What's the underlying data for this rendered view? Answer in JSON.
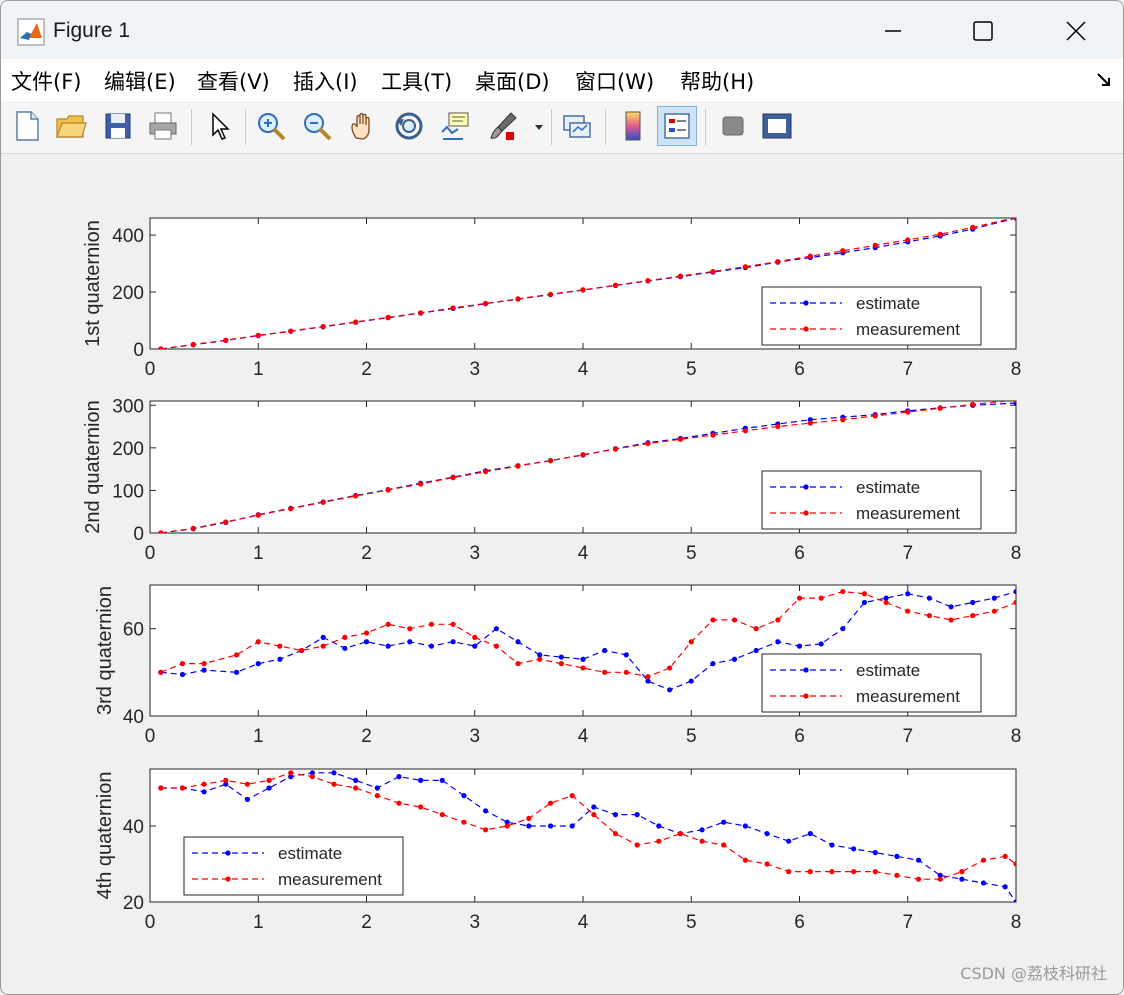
{
  "window": {
    "title": "Figure 1"
  },
  "menu": [
    {
      "label": "文件(F)"
    },
    {
      "label": "编辑(E)"
    },
    {
      "label": "查看(V)"
    },
    {
      "label": "插入(I)"
    },
    {
      "label": "工具(T)"
    },
    {
      "label": "桌面(D)"
    },
    {
      "label": "窗口(W)"
    },
    {
      "label": "帮助(H)"
    }
  ],
  "toolbar": [
    {
      "icon": "new-figure-icon"
    },
    {
      "icon": "open-file-icon"
    },
    {
      "icon": "save-icon"
    },
    {
      "icon": "print-icon"
    },
    {
      "icon": "pointer-icon"
    },
    {
      "icon": "zoom-in-icon"
    },
    {
      "icon": "zoom-out-icon"
    },
    {
      "icon": "pan-hand-icon"
    },
    {
      "icon": "rotate-3d-icon"
    },
    {
      "icon": "data-cursor-icon"
    },
    {
      "icon": "brush-icon"
    },
    {
      "icon": "link-plot-icon"
    },
    {
      "icon": "colorbar-icon"
    },
    {
      "icon": "legend-icon"
    },
    {
      "icon": "hide-plot-tools-icon"
    },
    {
      "icon": "show-plot-tools-icon"
    }
  ],
  "colors": {
    "estimate": "#0000ff",
    "measurement": "#ff0000"
  },
  "watermark": "CSDN @荔枝科研社",
  "chart_data": [
    {
      "type": "line",
      "ylabel": "1st quaternion",
      "xlim": [
        0,
        8
      ],
      "ylim": [
        0,
        460
      ],
      "xticks": [
        "0",
        "1",
        "2",
        "3",
        "4",
        "5",
        "6",
        "7",
        "8"
      ],
      "yticks": [
        0,
        200,
        400
      ],
      "grid": false,
      "legend": "bottom-right",
      "series": [
        {
          "name": "estimate",
          "color": "#0000ff",
          "x": [
            0.1,
            0.4,
            0.7,
            1.0,
            1.3,
            1.6,
            1.9,
            2.2,
            2.5,
            2.8,
            3.1,
            3.4,
            3.7,
            4.0,
            4.3,
            4.6,
            4.9,
            5.2,
            5.5,
            5.8,
            6.1,
            6.4,
            6.7,
            7.0,
            7.3,
            7.6,
            8.0
          ],
          "y": [
            0,
            15,
            30,
            47,
            62,
            78,
            94,
            110,
            126,
            142,
            159,
            175,
            191,
            207,
            223,
            239,
            254,
            270,
            286,
            305,
            321,
            338,
            356,
            376,
            397,
            421,
            460
          ]
        },
        {
          "name": "measurement",
          "color": "#ff0000",
          "x": [
            0.1,
            0.4,
            0.7,
            1.0,
            1.3,
            1.6,
            1.9,
            2.2,
            2.5,
            2.8,
            3.1,
            3.4,
            3.7,
            4.0,
            4.3,
            4.6,
            4.9,
            5.2,
            5.5,
            5.8,
            6.1,
            6.4,
            6.7,
            7.0,
            7.3,
            7.6,
            8.0
          ],
          "y": [
            0,
            16,
            31,
            48,
            63,
            79,
            95,
            111,
            127,
            144,
            160,
            176,
            192,
            208,
            224,
            240,
            256,
            272,
            289,
            307,
            326,
            345,
            364,
            383,
            403,
            427,
            462
          ]
        }
      ]
    },
    {
      "type": "line",
      "ylabel": "2nd quaternion",
      "xlim": [
        0,
        8
      ],
      "ylim": [
        0,
        310
      ],
      "xticks": [
        "0",
        "1",
        "2",
        "3",
        "4",
        "5",
        "6",
        "7",
        "8"
      ],
      "yticks": [
        0,
        100,
        200,
        300
      ],
      "grid": false,
      "legend": "bottom-right",
      "series": [
        {
          "name": "estimate",
          "color": "#0000ff",
          "x": [
            0.1,
            0.4,
            0.7,
            1.0,
            1.3,
            1.6,
            1.9,
            2.2,
            2.5,
            2.8,
            3.1,
            3.4,
            3.7,
            4.0,
            4.3,
            4.6,
            4.9,
            5.2,
            5.5,
            5.8,
            6.1,
            6.4,
            6.7,
            7.0,
            7.3,
            7.6,
            8.0
          ],
          "y": [
            0,
            10,
            25,
            43,
            58,
            73,
            88,
            102,
            117,
            131,
            146,
            158,
            170,
            183,
            198,
            212,
            222,
            234,
            246,
            256,
            266,
            272,
            278,
            287,
            294,
            300,
            305
          ]
        },
        {
          "name": "measurement",
          "color": "#ff0000",
          "x": [
            0.1,
            0.4,
            0.7,
            1.0,
            1.3,
            1.6,
            1.9,
            2.2,
            2.5,
            2.8,
            3.1,
            3.4,
            3.7,
            4.0,
            4.3,
            4.6,
            4.9,
            5.2,
            5.5,
            5.8,
            6.1,
            6.4,
            6.7,
            7.0,
            7.3,
            7.6,
            8.0
          ],
          "y": [
            0,
            11,
            26,
            42,
            57,
            72,
            87,
            101,
            115,
            130,
            144,
            157,
            170,
            184,
            197,
            210,
            220,
            230,
            240,
            250,
            258,
            266,
            275,
            284,
            293,
            302,
            312
          ]
        }
      ]
    },
    {
      "type": "line",
      "ylabel": "3rd quaternion",
      "xlim": [
        0,
        8
      ],
      "ylim": [
        40,
        70
      ],
      "xticks": [
        "0",
        "1",
        "2",
        "3",
        "4",
        "5",
        "6",
        "7",
        "8"
      ],
      "yticks": [
        40,
        60
      ],
      "grid": false,
      "legend": "bottom-right",
      "series": [
        {
          "name": "estimate",
          "color": "#0000ff",
          "x": [
            0.1,
            0.3,
            0.5,
            0.8,
            1.0,
            1.2,
            1.4,
            1.6,
            1.8,
            2.0,
            2.2,
            2.4,
            2.6,
            2.8,
            3.0,
            3.2,
            3.4,
            3.6,
            3.8,
            4.0,
            4.2,
            4.4,
            4.6,
            4.8,
            5.0,
            5.2,
            5.4,
            5.6,
            5.8,
            6.0,
            6.2,
            6.4,
            6.6,
            6.8,
            7.0,
            7.2,
            7.4,
            7.6,
            7.8,
            8.0
          ],
          "y": [
            50,
            49.5,
            50.5,
            50,
            52,
            53,
            55,
            58,
            55.5,
            57,
            56,
            57,
            56,
            57,
            56,
            60,
            57,
            54,
            53.5,
            53,
            55,
            54,
            48,
            46,
            48,
            52,
            53,
            55,
            57,
            56,
            56.5,
            60,
            66,
            67,
            68,
            67,
            65,
            66,
            67,
            68.5
          ]
        },
        {
          "name": "measurement",
          "color": "#ff0000",
          "x": [
            0.1,
            0.3,
            0.5,
            0.8,
            1.0,
            1.2,
            1.4,
            1.6,
            1.8,
            2.0,
            2.2,
            2.4,
            2.6,
            2.8,
            3.0,
            3.2,
            3.4,
            3.6,
            3.8,
            4.0,
            4.2,
            4.4,
            4.6,
            4.8,
            5.0,
            5.2,
            5.4,
            5.6,
            5.8,
            6.0,
            6.2,
            6.4,
            6.6,
            6.8,
            7.0,
            7.2,
            7.4,
            7.6,
            7.8,
            8.0
          ],
          "y": [
            50,
            52,
            52,
            54,
            57,
            56,
            55,
            56,
            58,
            59,
            61,
            60,
            61,
            61,
            58,
            56,
            52,
            53,
            52,
            51,
            50,
            50,
            49,
            51,
            57,
            62,
            62,
            60,
            62,
            67,
            67,
            68.5,
            68,
            66,
            64,
            63,
            62,
            63,
            64,
            66
          ]
        }
      ]
    },
    {
      "type": "line",
      "ylabel": "4th quaternion",
      "xlim": [
        0,
        8
      ],
      "ylim": [
        20,
        55
      ],
      "xticks": [
        "0",
        "1",
        "2",
        "3",
        "4",
        "5",
        "6",
        "7",
        "8"
      ],
      "yticks": [
        20,
        40
      ],
      "grid": false,
      "legend": "bottom-left",
      "series": [
        {
          "name": "estimate",
          "color": "#0000ff",
          "x": [
            0.1,
            0.3,
            0.5,
            0.7,
            0.9,
            1.1,
            1.3,
            1.5,
            1.7,
            1.9,
            2.1,
            2.3,
            2.5,
            2.7,
            2.9,
            3.1,
            3.3,
            3.5,
            3.7,
            3.9,
            4.1,
            4.3,
            4.5,
            4.7,
            4.9,
            5.1,
            5.3,
            5.5,
            5.7,
            5.9,
            6.1,
            6.3,
            6.5,
            6.7,
            6.9,
            7.1,
            7.3,
            7.5,
            7.7,
            7.9,
            8.0
          ],
          "y": [
            50,
            50,
            49,
            51,
            47,
            50,
            53,
            54,
            54,
            52,
            50,
            53,
            52,
            52,
            48,
            44,
            41,
            40,
            40,
            40,
            45,
            43,
            43,
            40,
            38,
            39,
            41,
            40,
            38,
            36,
            38,
            35,
            34,
            33,
            32,
            31,
            27,
            26,
            25,
            24,
            20
          ]
        },
        {
          "name": "measurement",
          "color": "#ff0000",
          "x": [
            0.1,
            0.3,
            0.5,
            0.7,
            0.9,
            1.1,
            1.3,
            1.5,
            1.7,
            1.9,
            2.1,
            2.3,
            2.5,
            2.7,
            2.9,
            3.1,
            3.3,
            3.5,
            3.7,
            3.9,
            4.1,
            4.3,
            4.5,
            4.7,
            4.9,
            5.1,
            5.3,
            5.5,
            5.7,
            5.9,
            6.1,
            6.3,
            6.5,
            6.7,
            6.9,
            7.1,
            7.3,
            7.5,
            7.7,
            7.9,
            8.0
          ],
          "y": [
            50,
            50,
            51,
            52,
            51,
            52,
            54,
            53,
            51,
            50,
            48,
            46,
            45,
            43,
            41,
            39,
            40,
            42,
            46,
            48,
            43,
            38,
            35,
            36,
            38,
            36,
            35,
            31,
            30,
            28,
            28,
            28,
            28,
            28,
            27,
            26,
            26,
            28,
            31,
            32,
            30
          ]
        }
      ]
    }
  ]
}
